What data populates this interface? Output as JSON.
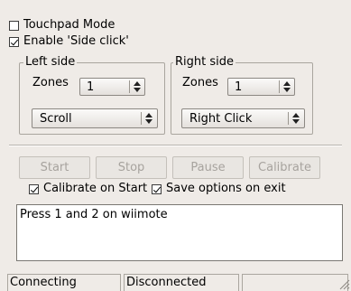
{
  "options": {
    "touchpad_mode": {
      "label": "Touchpad Mode",
      "checked": false
    },
    "enable_side_click": {
      "label": "Enable 'Side click'",
      "checked": true
    }
  },
  "left_side": {
    "title": "Left side",
    "zones_label": "Zones",
    "zones_value": "1",
    "action_value": "Scroll"
  },
  "right_side": {
    "title": "Right side",
    "zones_label": "Zones",
    "zones_value": "1",
    "action_value": "Right Click"
  },
  "buttons": {
    "start": "Start",
    "stop": "Stop",
    "pause": "Pause",
    "calibrate": "Calibrate"
  },
  "checks": {
    "calibrate_on_start": {
      "label": "Calibrate on Start",
      "checked": true
    },
    "save_options_on_exit": {
      "label": "Save options on exit",
      "checked": true
    }
  },
  "log": {
    "text": "Press 1 and 2 on wiimote"
  },
  "statusbar": {
    "connection": "Connecting",
    "state": "Disconnected",
    "extra": ""
  },
  "icons": {
    "spin_arrows": "up-down-arrows-icon",
    "resize_grip": "resize-grip-icon"
  }
}
